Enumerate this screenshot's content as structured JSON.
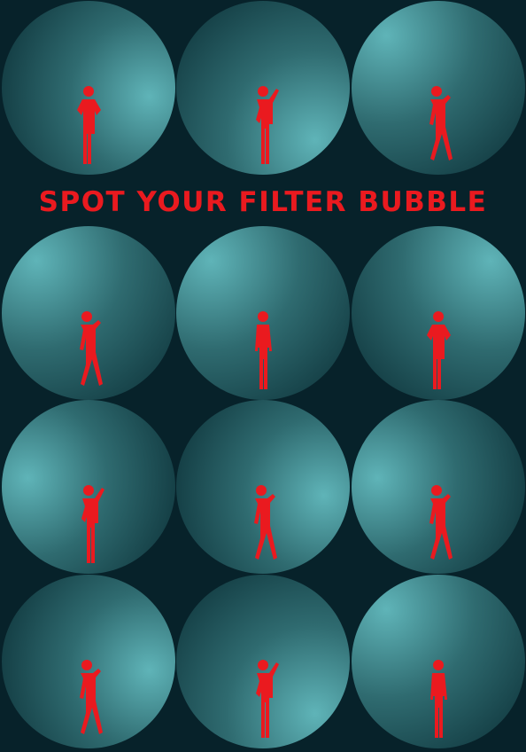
{
  "poster": {
    "title": "SPOT YOUR FILTER BUBBLE",
    "colors": {
      "background": "#07222a",
      "accent": "#ea1a1f",
      "bubble_light": "#5fb4b8",
      "bubble_dark": "#0b2f36"
    },
    "bubbles": [
      {
        "pose": "hands-on-hips",
        "light": "right"
      },
      {
        "pose": "waving",
        "light": "bottom-right"
      },
      {
        "pose": "phone-crossed-legs",
        "light": "top-left"
      },
      {
        "pose": "phone-crossed-legs",
        "light": "top-left"
      },
      {
        "pose": "standing",
        "light": "top-left"
      },
      {
        "pose": "hands-on-hips",
        "light": "top-right"
      },
      {
        "pose": "waving",
        "light": "left"
      },
      {
        "pose": "phone-crossed-legs",
        "light": "right"
      },
      {
        "pose": "phone-crossed-legs",
        "light": "left"
      },
      {
        "pose": "phone-crossed-legs",
        "light": "right"
      },
      {
        "pose": "waving",
        "light": "bottom-right"
      },
      {
        "pose": "standing",
        "light": "top-left"
      }
    ]
  }
}
